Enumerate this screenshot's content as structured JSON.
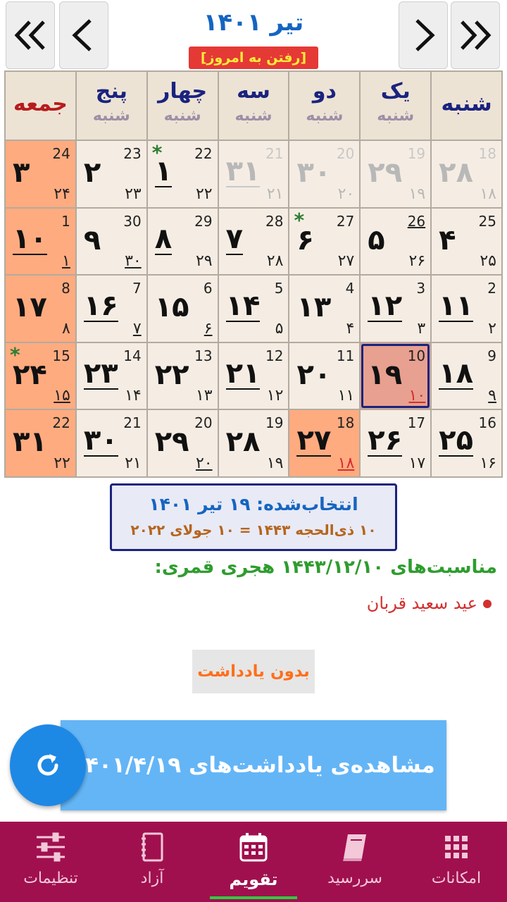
{
  "header": {
    "month_title": "تیر ۱۴۰۱",
    "today_button": "[رفتن به امروز]"
  },
  "weekdays": [
    {
      "name": "شنبه",
      "sub": ""
    },
    {
      "name": "یک",
      "sub": "شنبه"
    },
    {
      "name": "دو",
      "sub": "شنبه"
    },
    {
      "name": "سه",
      "sub": "شنبه"
    },
    {
      "name": "چهار",
      "sub": "شنبه"
    },
    {
      "name": "پنج",
      "sub": "شنبه"
    },
    {
      "name": "جمعه",
      "sub": ""
    }
  ],
  "weeks": [
    [
      {
        "main": "۲۸",
        "greg": "18",
        "lunar": "۱۸",
        "out": true
      },
      {
        "main": "۲۹",
        "greg": "19",
        "lunar": "۱۹",
        "out": true
      },
      {
        "main": "۳۰",
        "greg": "20",
        "lunar": "۲۰",
        "out": true
      },
      {
        "main": "۳۱",
        "greg": "21",
        "lunar": "۲۱",
        "out": true,
        "main_u": true
      },
      {
        "main": "۱",
        "greg": "22",
        "lunar": "۲۲",
        "star": true,
        "main_u": true
      },
      {
        "main": "۲",
        "greg": "23",
        "lunar": "۲۳"
      },
      {
        "main": "۳",
        "greg": "24",
        "lunar": "۲۴",
        "fri": true
      }
    ],
    [
      {
        "main": "۴",
        "greg": "25",
        "lunar": "۲۵"
      },
      {
        "main": "۵",
        "greg": "26",
        "lunar": "۲۶",
        "greg_u": true
      },
      {
        "main": "۶",
        "greg": "27",
        "lunar": "۲۷",
        "star": true
      },
      {
        "main": "۷",
        "greg": "28",
        "lunar": "۲۸",
        "main_u": true
      },
      {
        "main": "۸",
        "greg": "29",
        "lunar": "۲۹",
        "main_u": true
      },
      {
        "main": "۹",
        "greg": "30",
        "lunar": "۳۰",
        "lunar_u": true
      },
      {
        "main": "۱۰",
        "greg": "1",
        "lunar": "۱",
        "fri": true,
        "main_u": true,
        "lunar_u": true
      }
    ],
    [
      {
        "main": "۱۱",
        "greg": "2",
        "lunar": "۲",
        "main_u": true
      },
      {
        "main": "۱۲",
        "greg": "3",
        "lunar": "۳",
        "main_u": true
      },
      {
        "main": "۱۳",
        "greg": "4",
        "lunar": "۴"
      },
      {
        "main": "۱۴",
        "greg": "5",
        "lunar": "۵",
        "main_u": true
      },
      {
        "main": "۱۵",
        "greg": "6",
        "lunar": "۶",
        "lunar_u": true
      },
      {
        "main": "۱۶",
        "greg": "7",
        "lunar": "۷",
        "main_u": true,
        "lunar_u": true
      },
      {
        "main": "۱۷",
        "greg": "8",
        "lunar": "۸",
        "fri": true
      }
    ],
    [
      {
        "main": "۱۸",
        "greg": "9",
        "lunar": "۹",
        "main_u": true,
        "lunar_u": true
      },
      {
        "main": "۱۹",
        "greg": "10",
        "lunar": "۱۰",
        "sel": true,
        "lunar_red": true,
        "lunar_u": true
      },
      {
        "main": "۲۰",
        "greg": "11",
        "lunar": "۱۱"
      },
      {
        "main": "۲۱",
        "greg": "12",
        "lunar": "۱۲",
        "main_u": true
      },
      {
        "main": "۲۲",
        "greg": "13",
        "lunar": "۱۳"
      },
      {
        "main": "۲۳",
        "greg": "14",
        "lunar": "۱۴",
        "main_u": true
      },
      {
        "main": "۲۴",
        "greg": "15",
        "lunar": "۱۵",
        "fri": true,
        "star": true,
        "lunar_u": true
      }
    ],
    [
      {
        "main": "۲۵",
        "greg": "16",
        "lunar": "۱۶",
        "main_u": true
      },
      {
        "main": "۲۶",
        "greg": "17",
        "lunar": "۱۷",
        "main_u": true
      },
      {
        "main": "۲۷",
        "greg": "18",
        "lunar": "۱۸",
        "hol": true,
        "lunar_red": true,
        "main_u": true,
        "lunar_u": true
      },
      {
        "main": "۲۸",
        "greg": "19",
        "lunar": "۱۹"
      },
      {
        "main": "۲۹",
        "greg": "20",
        "lunar": "۲۰",
        "lunar_u": true
      },
      {
        "main": "۳۰",
        "greg": "21",
        "lunar": "۲۱",
        "main_u": true
      },
      {
        "main": "۳۱",
        "greg": "22",
        "lunar": "۲۲",
        "fri": true
      }
    ]
  ],
  "selected": {
    "line1": "انتخاب‌شده: ۱۹ تیر ۱۴۰۱",
    "line2": "۱۰ ذی‌الحجه ۱۴۴۳ = ۱۰ جولای ۲۰۲۲"
  },
  "occasions": {
    "title": "مناسبت‌های ۱۴۴۳/۱۲/۱۰ هجری قمری:",
    "items": [
      "عید سعید قربان"
    ]
  },
  "no_note_label": "بدون یادداشت",
  "view_notes_label": "مشاهده‌ی یادداشت‌های ۱۴۰۱/۴/۱۹",
  "bottom_nav": [
    {
      "label": "امکانات",
      "icon": "grid-icon"
    },
    {
      "label": "سررسید",
      "icon": "book-icon"
    },
    {
      "label": "تقویم",
      "icon": "calendar-icon",
      "active": true
    },
    {
      "label": "آزاد",
      "icon": "notebook-icon"
    },
    {
      "label": "تنظیمات",
      "icon": "sliders-icon"
    }
  ],
  "colors": {
    "accent_blue": "#1565c0",
    "friday_bg": "#ffab80",
    "selected_bg": "#e8a090",
    "nav_bg": "#a0104f",
    "occasion_green": "#2e9d2e",
    "occasion_red": "#d32f2f"
  }
}
